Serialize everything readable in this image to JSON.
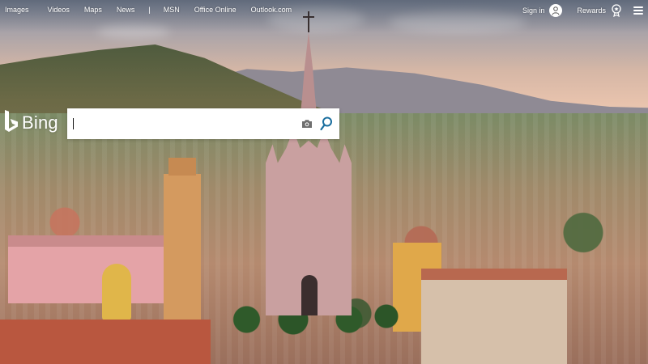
{
  "nav": {
    "items": [
      {
        "label": "Images"
      },
      {
        "label": "Videos"
      },
      {
        "label": "Maps"
      },
      {
        "label": "News"
      }
    ],
    "separator": "|",
    "extra_items": [
      {
        "label": "MSN"
      },
      {
        "label": "Office Online"
      },
      {
        "label": "Outlook.com"
      }
    ]
  },
  "account": {
    "sign_in_label": "Sign in",
    "rewards_label": "Rewards",
    "avatar_icon": "person-icon",
    "rewards_icon": "medal-icon",
    "menu_icon": "hamburger-icon"
  },
  "brand": {
    "logo_text": "Bing",
    "logo_color": "#ffffff"
  },
  "search": {
    "value": "",
    "placeholder": "",
    "camera_icon": "camera-icon",
    "search_icon": "search-icon",
    "accent": "#1a6e9e"
  },
  "background": {
    "subject": "city-cathedral-photo"
  }
}
